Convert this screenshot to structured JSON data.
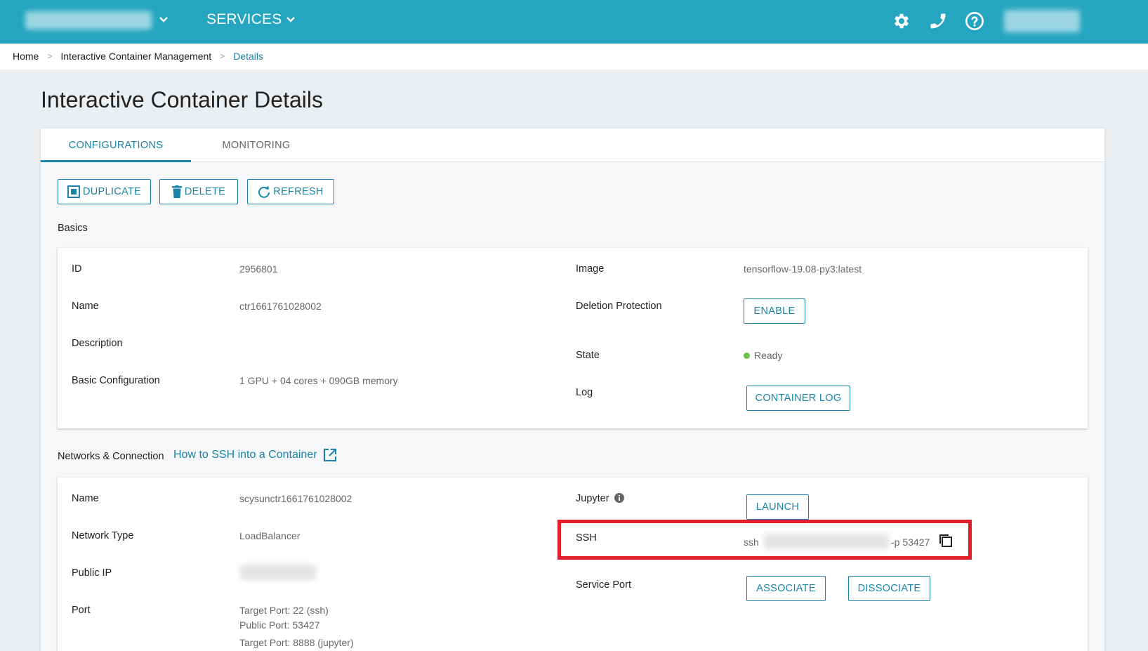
{
  "header": {
    "services_label": "SERVICES",
    "icons": [
      "gear-icon",
      "phone-icon",
      "help-icon"
    ]
  },
  "breadcrumb": {
    "items": [
      "Home",
      "Interactive Container Management",
      "Details"
    ],
    "separator": ">"
  },
  "page": {
    "title": "Interactive Container Details"
  },
  "tabs": [
    {
      "label": "CONFIGURATIONS",
      "active": true
    },
    {
      "label": "MONITORING",
      "active": false
    }
  ],
  "actions": {
    "duplicate": "DUPLICATE",
    "delete": "DELETE",
    "refresh": "REFRESH"
  },
  "basics": {
    "section_label": "Basics",
    "left": [
      {
        "label": "ID",
        "value": "2956801"
      },
      {
        "label": "Name",
        "value": "ctr1661761028002"
      },
      {
        "label": "Description",
        "value": ""
      },
      {
        "label": "Basic Configuration",
        "value": "1 GPU + 04 cores + 090GB memory"
      }
    ],
    "image": {
      "label": "Image",
      "value": "tensorflow-19.08-py3:latest"
    },
    "deletion_protection": {
      "label": "Deletion Protection",
      "button": "ENABLE"
    },
    "state": {
      "label": "State",
      "value": "Ready"
    },
    "log": {
      "label": "Log",
      "button": "CONTAINER LOG"
    }
  },
  "network": {
    "section_label": "Networks & Connection",
    "help_link": "How to SSH into a Container",
    "name": {
      "label": "Name",
      "value": "scysunctr1661761028002"
    },
    "network_type": {
      "label": "Network Type",
      "value": "LoadBalancer"
    },
    "public_ip": {
      "label": "Public IP"
    },
    "port": {
      "label": "Port",
      "values": [
        "Target Port: 22 (ssh)",
        "Public Port: 53427",
        "Target Port: 8888 (jupyter)"
      ]
    },
    "jupyter": {
      "label": "Jupyter",
      "button": "LAUNCH"
    },
    "ssh": {
      "label": "SSH",
      "prefix": "ssh",
      "suffix": "-p 53427"
    },
    "service_port": {
      "label": "Service Port",
      "associate": "ASSOCIATE",
      "dissociate": "DISSOCIATE"
    }
  },
  "colors": {
    "topbar": "#24a5c0",
    "accent": "#1a84a8",
    "highlight": "#e31e2b",
    "status_ready": "#6cc24a"
  }
}
